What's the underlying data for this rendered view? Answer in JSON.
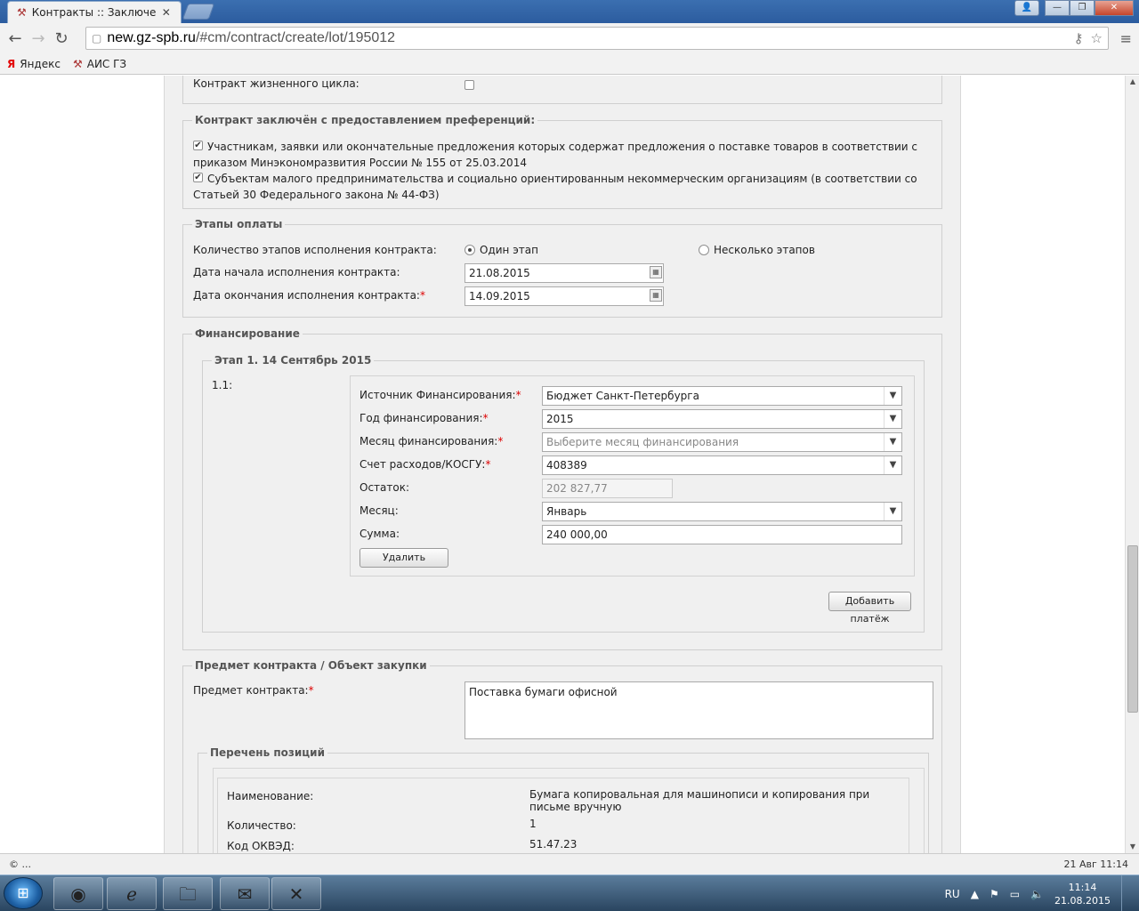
{
  "browser": {
    "tab_title": "Контракты :: Заключение",
    "tab_close": "✕",
    "url_host": "new.gz-spb.ru",
    "url_path": "/#cm/contract/create/lot/195012",
    "bookmarks": [
      {
        "label": "Яндекс",
        "icon": "Я"
      },
      {
        "label": "АИС ГЗ",
        "icon": "⚒"
      }
    ]
  },
  "form": {
    "lifecycle_label": "Контракт жизненного цикла:",
    "preferences": {
      "legend": "Контракт заключён с предоставлением преференций:",
      "option1": "Участникам, заявки или окончательные предложения которых содержат предложения о поставке товаров в соответствии с приказом Минэкономразвития России № 155 от 25.03.2014",
      "option2": "Субъектам малого предпринимательства и социально ориентированным некоммерческим организациям (в соответствии со Статьей 30 Федерального закона № 44-ФЗ)"
    },
    "payment_stages": {
      "legend": "Этапы оплаты",
      "count_label": "Количество этапов исполнения контракта:",
      "radio_single": "Один этап",
      "radio_multi": "Несколько этапов",
      "start_label": "Дата начала исполнения контракта:",
      "start_value": "21.08.2015",
      "end_label": "Дата окончания исполнения контракта:",
      "end_value": "14.09.2015"
    },
    "financing": {
      "legend": "Финансирование",
      "stage_legend": "Этап 1. 14 Сентябрь 2015",
      "item_no": "1.1:",
      "source_label": "Источник Финансирования:",
      "source_value": "Бюджет Санкт-Петербурга",
      "year_label": "Год финансирования:",
      "year_value": "2015",
      "month_fin_label": "Месяц финансирования:",
      "month_fin_placeholder": "Выберите месяц финансирования",
      "account_label": "Счет расходов/КОСГУ:",
      "account_value": "408389",
      "balance_label": "Остаток:",
      "balance_value": "202 827,77",
      "month_label": "Месяц:",
      "month_value": "Январь",
      "sum_label": "Сумма:",
      "sum_value": "240 000,00",
      "delete_button": "Удалить",
      "add_payment_button": "Добавить платёж"
    },
    "subject": {
      "legend": "Предмет контракта / Объект закупки",
      "subject_label": "Предмет контракта:",
      "subject_value": "Поставка бумаги офисной",
      "positions_legend": "Перечень позиций",
      "name_label": "Наименование:",
      "name_value": "Бумага копировальная для машинописи и копирования при письме вручную",
      "qty_label": "Количество:",
      "qty_value": "1",
      "okved_label": "Код ОКВЭД:",
      "okved_value": "51.47.23"
    }
  },
  "statusbar": {
    "left": "© ...",
    "right": "21 Авг 11:14"
  },
  "taskbar": {
    "lang": "RU",
    "time": "11:14",
    "date": "21.08.2015"
  }
}
